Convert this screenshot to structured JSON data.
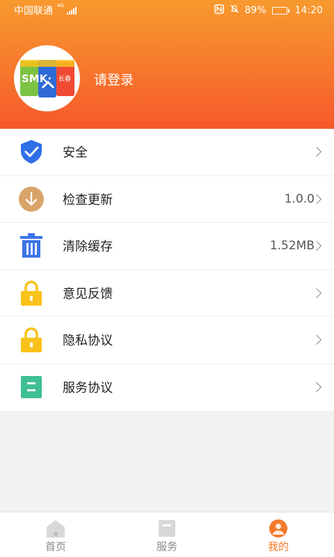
{
  "status_bar": {
    "carrier": "中国联通",
    "network": "4G",
    "battery": "89%",
    "battery_level": 0.89,
    "time": "14:20"
  },
  "profile": {
    "logo_text": "SMK·",
    "logo_subtext": "长春",
    "login_label": "请登录"
  },
  "menu": [
    {
      "label": "安全",
      "value": "",
      "icon": "shield-check-icon"
    },
    {
      "label": "检查更新",
      "value": "1.0.0",
      "icon": "download-arrow-icon"
    },
    {
      "label": "清除缓存",
      "value": "1.52MB",
      "icon": "trash-icon"
    },
    {
      "label": "意见反馈",
      "value": "",
      "icon": "lock-icon"
    },
    {
      "label": "隐私协议",
      "value": "",
      "icon": "lock-icon"
    },
    {
      "label": "服务协议",
      "value": "",
      "icon": "document-icon"
    }
  ],
  "tabs": [
    {
      "label": "首页",
      "icon": "home-icon"
    },
    {
      "label": "服务",
      "icon": "bookmark-icon"
    },
    {
      "label": "我的",
      "icon": "person-icon"
    }
  ],
  "colors": {
    "header_top": "#f79a2e",
    "header_bottom": "#f5582a",
    "active_tab": "#f47a2b",
    "shield_blue": "#2f6fe8",
    "update_tan": "#d9a46a",
    "trash_blue": "#3b74e8",
    "lock_yellow": "#f8c21a",
    "doc_green": "#3fbf95"
  }
}
